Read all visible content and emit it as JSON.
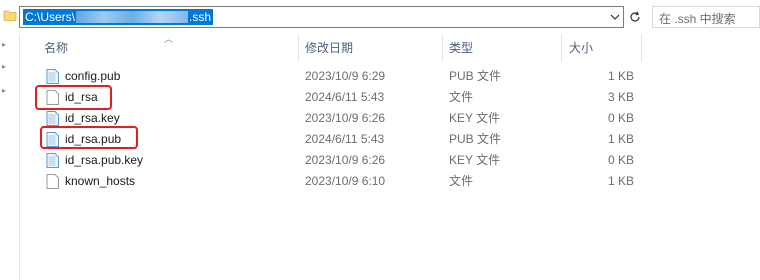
{
  "address_bar": {
    "path_prefix": "C:\\Users\\",
    "path_suffix": ".ssh",
    "search_placeholder": "在 .ssh 中搜索"
  },
  "columns": {
    "name": "名称",
    "date": "修改日期",
    "type": "类型",
    "size": "大小"
  },
  "files": [
    {
      "name": "config.pub",
      "date": "2023/10/9 6:29",
      "type": "PUB 文件",
      "size": "1 KB",
      "icon": "pub-file-icon",
      "highlighted": false
    },
    {
      "name": "id_rsa",
      "date": "2024/6/11 5:43",
      "type": "文件",
      "size": "3 KB",
      "icon": "blank-file-icon",
      "highlighted": true
    },
    {
      "name": "id_rsa.key",
      "date": "2023/10/9 6:26",
      "type": "KEY 文件",
      "size": "0 KB",
      "icon": "key-file-icon",
      "highlighted": false
    },
    {
      "name": "id_rsa.pub",
      "date": "2024/6/11 5:43",
      "type": "PUB 文件",
      "size": "1 KB",
      "icon": "pub-file-icon",
      "highlighted": true
    },
    {
      "name": "id_rsa.pub.key",
      "date": "2023/10/9 6:26",
      "type": "KEY 文件",
      "size": "0 KB",
      "icon": "key-file-icon",
      "highlighted": false
    },
    {
      "name": "known_hosts",
      "date": "2023/10/9 6:10",
      "type": "文件",
      "size": "1 KB",
      "icon": "blank-file-icon",
      "highlighted": false
    }
  ],
  "colors": {
    "selection": "#0078d7",
    "highlight_box": "#e02020",
    "header_text": "#4c607a"
  }
}
